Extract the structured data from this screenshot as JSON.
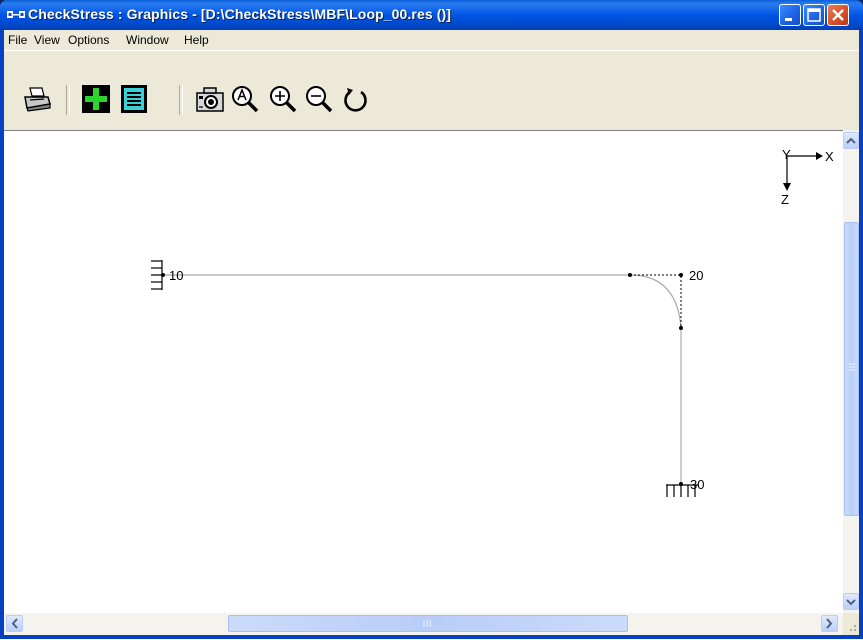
{
  "window": {
    "title": "CheckStress : Graphics -  [D:\\CheckStress\\MBF\\Loop_00.res ()]"
  },
  "menu": {
    "items": [
      {
        "label": "File"
      },
      {
        "label": "View"
      },
      {
        "label": "Options"
      },
      {
        "label": "Window"
      },
      {
        "label": "Help"
      }
    ]
  },
  "toolbar": {
    "tools": [
      {
        "icon": "printer-icon"
      },
      {
        "icon": "add-green-icon"
      },
      {
        "icon": "document-list-icon"
      },
      {
        "icon": "camera-icon"
      },
      {
        "icon": "zoom-all-icon"
      },
      {
        "icon": "zoom-in-icon"
      },
      {
        "icon": "zoom-out-icon"
      },
      {
        "icon": "rotate-icon"
      }
    ]
  },
  "graphics": {
    "axes": {
      "x_label": "X",
      "y_label": "Y",
      "z_label": "Z"
    },
    "nodes": {
      "n10": "10",
      "n20": "20",
      "n30": "30"
    }
  }
}
